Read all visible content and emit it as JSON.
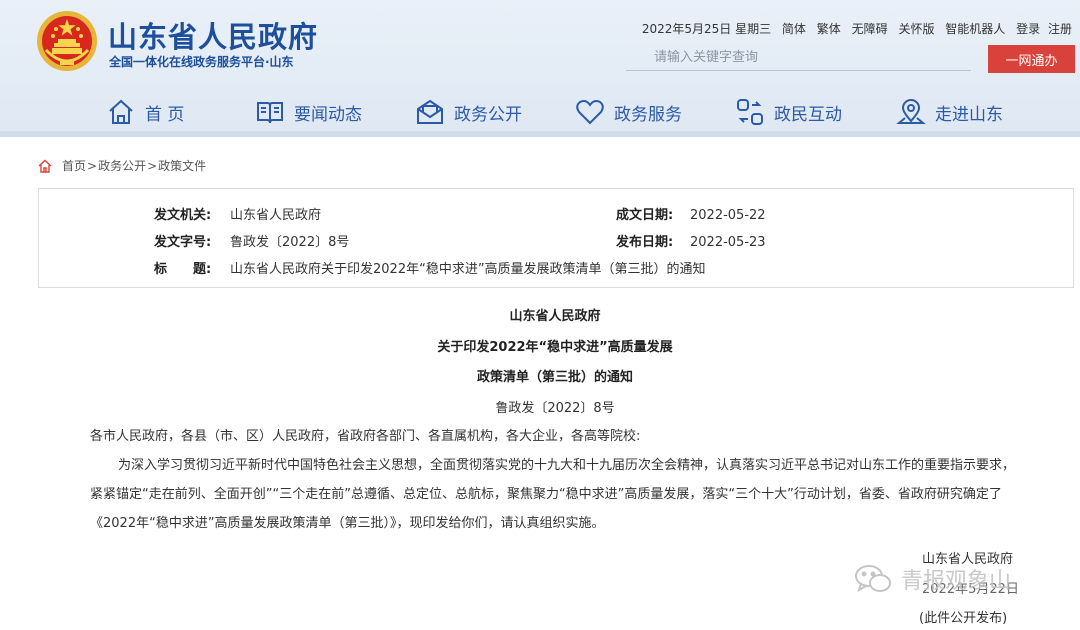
{
  "header": {
    "site_title": "山东省人民政府",
    "site_subtitle": "全国一体化在线政务服务平台·山东",
    "toplinks": [
      "2022年5月25日 星期三",
      "简体",
      "繁体",
      "无障碍",
      "关怀版",
      "智能机器人",
      "登录",
      "注册"
    ],
    "search_placeholder": "请输入关键字查询",
    "search_button": "一网通办"
  },
  "nav": [
    {
      "label": "首 页",
      "icon": "home-icon"
    },
    {
      "label": "要闻动态",
      "icon": "book-icon"
    },
    {
      "label": "政务公开",
      "icon": "envelope-icon"
    },
    {
      "label": "政务服务",
      "icon": "heart-icon"
    },
    {
      "label": "政民互动",
      "icon": "interaction-icon"
    },
    {
      "label": "走进山东",
      "icon": "location-icon"
    }
  ],
  "breadcrumb": {
    "items": [
      "首页",
      "政务公开",
      "政策文件"
    ],
    "separator": ">"
  },
  "meta": {
    "issuer_label": "发文机关:",
    "issuer": "山东省人民政府",
    "created_label": "成文日期:",
    "created": "2022-05-22",
    "docno_label": "发文字号:",
    "docno": "鲁政发〔2022〕8号",
    "published_label": "发布日期:",
    "published": "2022-05-23",
    "title_label": "标　　题:",
    "title": "山东省人民政府关于印发2022年“稳中求进”高质量发展政策清单（第三批）的通知"
  },
  "article": {
    "org": "山东省人民政府",
    "title_line1": "关于印发2022年“稳中求进”高质量发展",
    "title_line2": "政策清单（第三批）的通知",
    "docno": "鲁政发〔2022〕8号",
    "recipients": "各市人民政府，各县（市、区）人民政府，省政府各部门、各直属机构，各大企业，各高等院校:",
    "body": "为深入学习贯彻习近平新时代中国特色社会主义思想，全面贯彻落实党的十九大和十九届历次全会精神，认真落实习近平总书记对山东工作的重要指示要求，紧紧锚定“走在前列、全面开创”“三个走在前”总遵循、总定位、总航标，聚焦聚力“稳中求进”高质量发展，落实“三个十大”行动计划，省委、省政府研究确定了《2022年“稳中求进”高质量发展政策清单（第三批）》，现印发给你们，请认真组织实施。",
    "sign_org": "山东省人民政府",
    "sign_date": "2022年5月22日",
    "sign_note": "(此件公开发布)"
  },
  "watermark": "青报观象山",
  "colors": {
    "brand_blue": "#1e4f9c",
    "nav_blue": "#2b5aa6",
    "button_red": "#d9423a",
    "header_bg": "#e6edf6"
  }
}
